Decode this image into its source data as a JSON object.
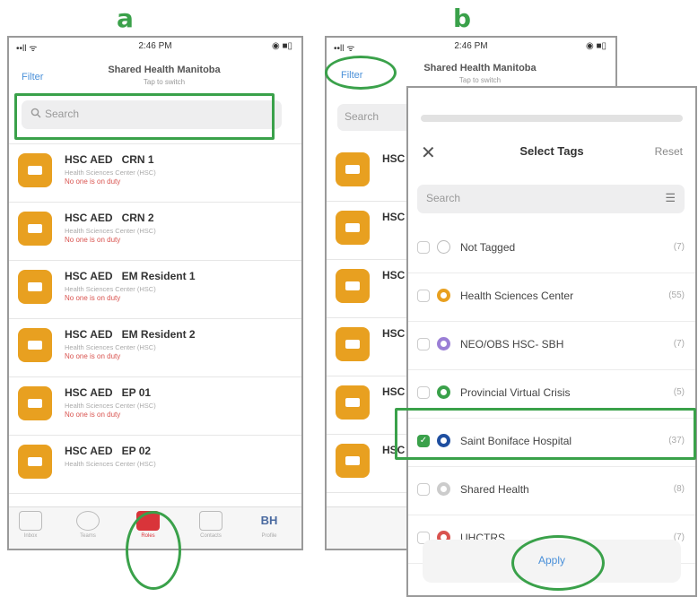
{
  "labels": {
    "a": "a",
    "b": "b"
  },
  "phone_a": {
    "status": {
      "left": "••ll ᯤ",
      "time": "2:46 PM",
      "right": "◉ ■▯"
    },
    "filter": "Filter",
    "title": "Shared Health Manitoba",
    "subtitle": "Tap to switch",
    "search_placeholder": "Search",
    "items": [
      {
        "title": "HSC AED   CRN 1",
        "org": "Health Sciences Center (HSC)",
        "status": "No one is on duty"
      },
      {
        "title": "HSC AED   CRN 2",
        "org": "Health Sciences Center (HSC)",
        "status": "No one is on duty"
      },
      {
        "title": "HSC AED   EM Resident 1",
        "org": "Health Sciences Center (HSC)",
        "status": "No one is on duty"
      },
      {
        "title": "HSC AED   EM Resident 2",
        "org": "Health Sciences Center (HSC)",
        "status": "No one is on duty"
      },
      {
        "title": "HSC AED   EP 01",
        "org": "Health Sciences Center (HSC)",
        "status": "No one is on duty"
      },
      {
        "title": "HSC AED   EP 02",
        "org": "Health Sciences Center (HSC)",
        "status": ""
      }
    ],
    "tabs": [
      "Inbox",
      "Teams",
      "Roles",
      "Contacts",
      "Profile"
    ],
    "avatar": "BH"
  },
  "phone_b": {
    "status": {
      "left": "••ll ᯤ",
      "time": "2:46 PM",
      "right": "◉ ■▯"
    },
    "filter": "Filter",
    "title": "Shared Health Manitoba",
    "subtitle": "Tap to switch",
    "search_placeholder": "Search",
    "items_prefix": "HSC"
  },
  "modal": {
    "title": "Select Tags",
    "reset": "Reset",
    "search_placeholder": "Search",
    "tags": [
      {
        "name": "Not Tagged",
        "count": "(7)",
        "checked": false,
        "color": "#ffffff"
      },
      {
        "name": "Health Sciences Center",
        "count": "(55)",
        "checked": false,
        "color": "#e8a020"
      },
      {
        "name": "NEO/OBS HSC- SBH",
        "count": "(7)",
        "checked": false,
        "color": "#9b7fd6"
      },
      {
        "name": "Provincial Virtual Crisis",
        "count": "(5)",
        "checked": false,
        "color": "#3aa14a"
      },
      {
        "name": "Saint Boniface Hospital",
        "count": "(37)",
        "checked": true,
        "color": "#1f4fa0"
      },
      {
        "name": "Shared Health",
        "count": "(8)",
        "checked": false,
        "color": "#cccccc"
      },
      {
        "name": "UHCTRS",
        "count": "(7)",
        "checked": false,
        "color": "#d9534f"
      }
    ],
    "apply": "Apply"
  },
  "colors": {
    "accent": "#3aa14a",
    "link": "#4a90d9",
    "role_icon": "#e8a020",
    "status_red": "#d9534f"
  }
}
